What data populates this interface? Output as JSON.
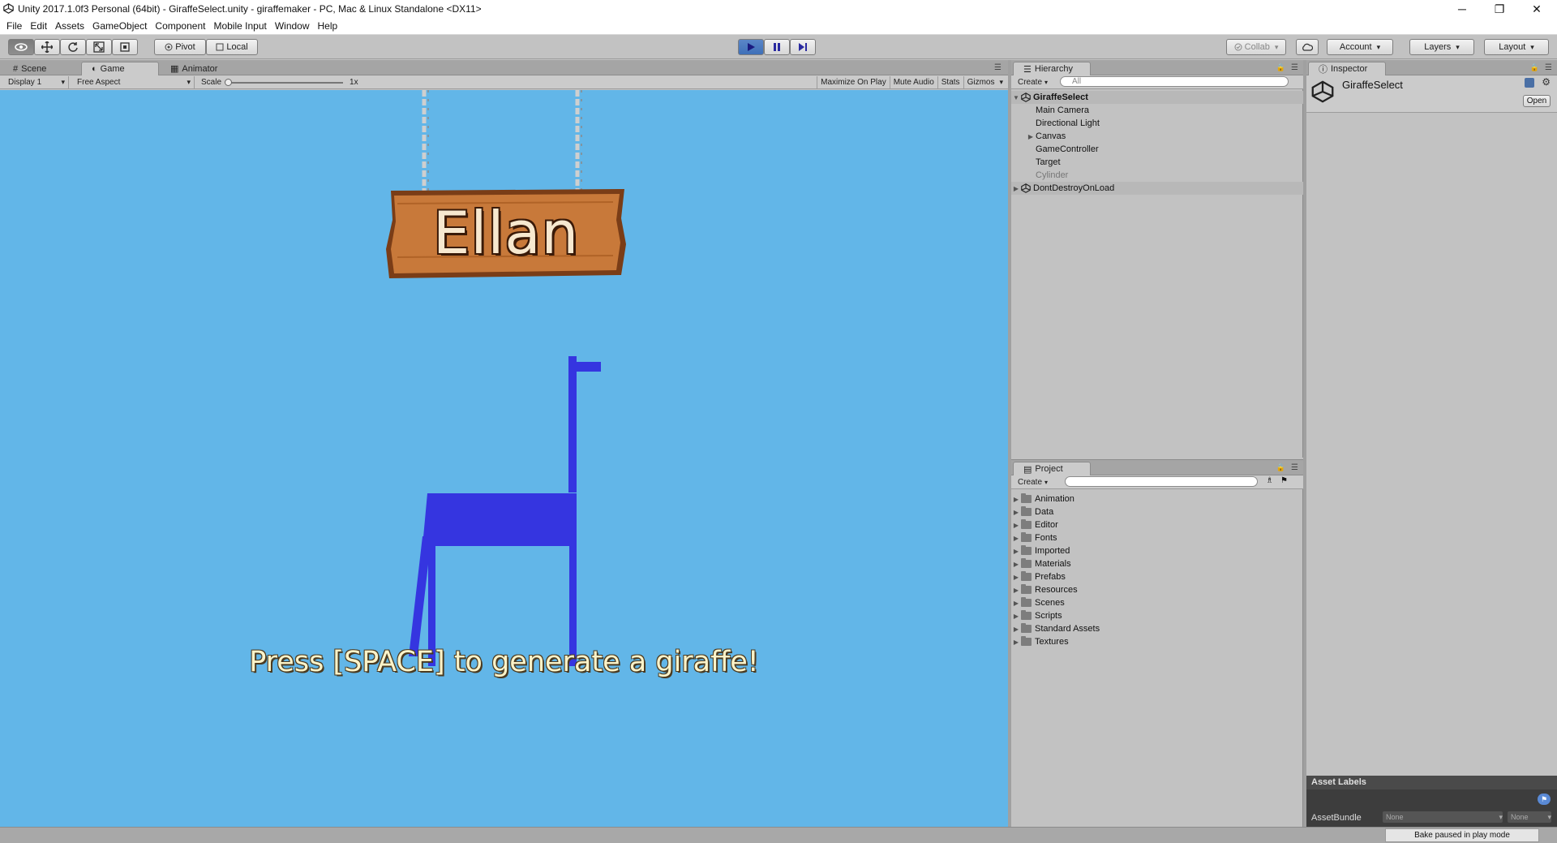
{
  "window": {
    "title": "Unity 2017.1.0f3 Personal (64bit) - GiraffeSelect.unity - giraffemaker - PC, Mac & Linux Standalone <DX11>",
    "controls": [
      "─",
      "❐",
      "✕"
    ]
  },
  "menu": [
    "File",
    "Edit",
    "Assets",
    "GameObject",
    "Component",
    "Mobile Input",
    "Window",
    "Help"
  ],
  "toolbar": {
    "pivot": "Pivot",
    "local": "Local",
    "collab": "Collab",
    "account": "Account",
    "layers": "Layers",
    "layout": "Layout"
  },
  "game_view": {
    "tabs": [
      "Scene",
      "Game",
      "Animator"
    ],
    "active_tab": "Game",
    "display": "Display 1",
    "aspect": "Free Aspect",
    "scale_label": "Scale",
    "scale_value": "1x",
    "options": [
      "Maximize On Play",
      "Mute Audio",
      "Stats",
      "Gizmos"
    ],
    "sign_text": "Ellan",
    "prompt_text": "Press [SPACE] to generate a giraffe!",
    "colors": {
      "sky": "#62b6e8",
      "giraffe": "#3535e0",
      "sign": "#c8793a",
      "sign_text": "#f7e8cf",
      "prompt_text": "#fbf3c9"
    }
  },
  "hierarchy": {
    "tab": "Hierarchy",
    "create": "Create",
    "search_placeholder": "All",
    "scene": "GiraffeSelect",
    "items": [
      "Main Camera",
      "Directional Light",
      "Canvas",
      "GameController",
      "Target",
      "Cylinder"
    ],
    "dont_destroy": "DontDestroyOnLoad"
  },
  "project": {
    "tab": "Project",
    "create": "Create",
    "folders": [
      "Animation",
      "Data",
      "Editor",
      "Fonts",
      "Imported",
      "Materials",
      "Prefabs",
      "Resources",
      "Scenes",
      "Scripts",
      "Standard Assets",
      "Textures"
    ]
  },
  "inspector": {
    "tab": "Inspector",
    "object": "GiraffeSelect",
    "open": "Open",
    "asset_labels": "Asset Labels",
    "asset_bundle_label": "AssetBundle",
    "asset_bundle_value": "None",
    "asset_bundle_variant": "None"
  },
  "status": {
    "bake": "Bake paused in play mode"
  }
}
